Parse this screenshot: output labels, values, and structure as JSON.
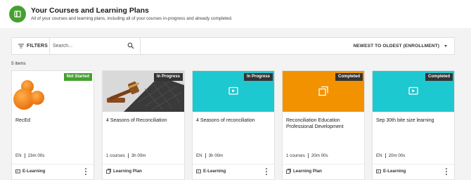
{
  "header": {
    "title": "Your Courses and Learning Plans",
    "subtitle": "All of your courses and learning plans, including all of your courses in-progress and already completed."
  },
  "toolbar": {
    "filters_label": "FILTERS",
    "search_placeholder": "Search...",
    "sort_label": "NEWEST TO OLDEST (ENROLLMENT)"
  },
  "items_count": "5 items",
  "colors": {
    "accent_green": "#45a02f",
    "teal": "#1ec8d0",
    "orange": "#f39200",
    "badge_dark": "#333333"
  },
  "cards": [
    {
      "title": "RecEd",
      "status": "Not Started",
      "meta_left": "EN",
      "meta_right": "23m 00s",
      "type": "E-Learning",
      "thumb": "orange-shapes"
    },
    {
      "title": "4 Seasons of Reconciliation",
      "status": "In Progress",
      "meta_left": "1 courses",
      "meta_right": "3h 00m",
      "type": "Learning Plan",
      "thumb": "gavel-keyboard-photo"
    },
    {
      "title": "4 Seasons of reconciliation",
      "status": "In Progress",
      "meta_left": "EN",
      "meta_right": "3h 00m",
      "type": "E-Learning",
      "thumb": "play-icon"
    },
    {
      "title": "Reconciliation Education Professional Development",
      "status": "Completed",
      "meta_left": "1 courses",
      "meta_right": "20m 00s",
      "type": "Learning Plan",
      "thumb": "copy-icon"
    },
    {
      "title": "Sep 30th bite size learning",
      "status": "Completed",
      "meta_left": "EN",
      "meta_right": "20m 00s",
      "type": "E-Learning",
      "thumb": "play-icon"
    }
  ]
}
